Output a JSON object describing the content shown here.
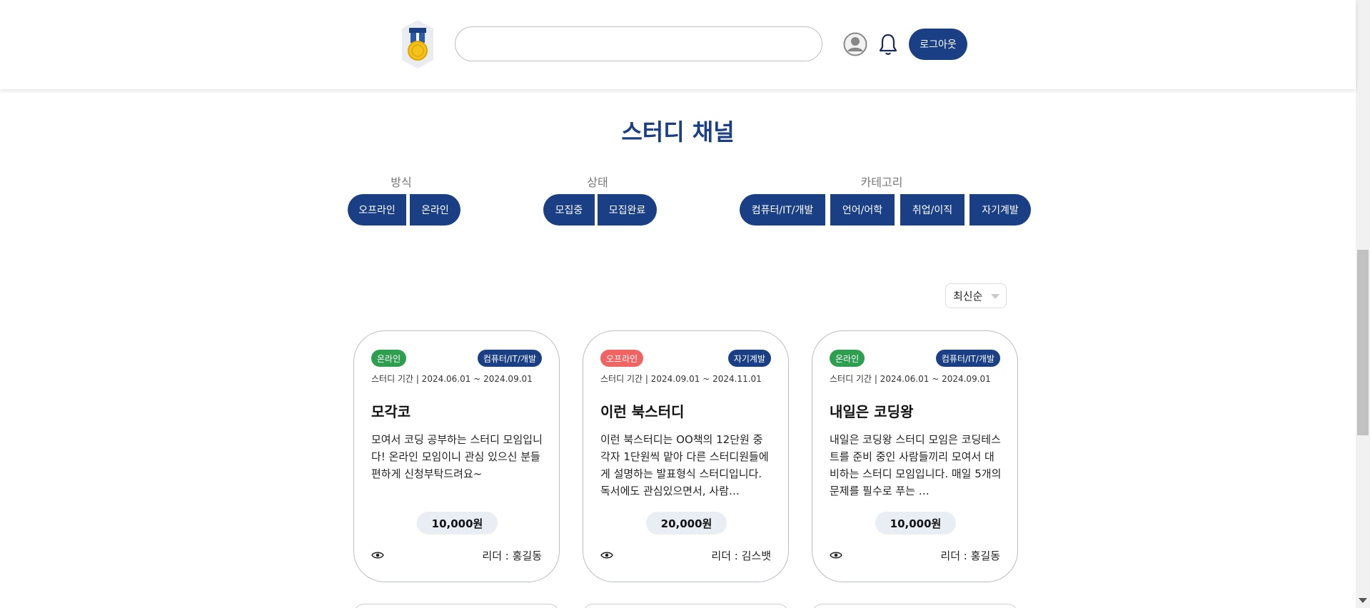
{
  "header": {
    "search_placeholder": "",
    "logout_label": "로그아웃"
  },
  "page": {
    "title": "스터디 채널"
  },
  "filters": {
    "method": {
      "label": "방식",
      "options": [
        "오프라인",
        "온라인"
      ]
    },
    "status": {
      "label": "상태",
      "options": [
        "모집중",
        "모집완료"
      ]
    },
    "category": {
      "label": "카테고리",
      "options": [
        "컴퓨터/IT/개발",
        "언어/어학",
        "취업/이직",
        "자기계발"
      ]
    }
  },
  "sort": {
    "selected": "최신순"
  },
  "cards": [
    {
      "mode": "온라인",
      "mode_color": "#2e9e4f",
      "category": "컴퓨터/IT/개발",
      "period": "스터디 기간 | 2024.06.01 ~ 2024.09.01",
      "title": "모각코",
      "description": "모여서 코딩 공부하는 스터디 모임입니다! 온라인 모임이니 관심 있으신 분들 편하게 신청부탁드려요~",
      "price": "10,000원",
      "leader": "리더 : 홍길동"
    },
    {
      "mode": "오프라인",
      "mode_color": "#f06464",
      "category": "자기계발",
      "period": "스터디 기간 | 2024.09.01 ~ 2024.11.01",
      "title": "이런 북스터디",
      "description": "이런 북스터디는 OO책의 12단원 중 각자 1단원씩 맡아 다른 스터디원들에게 설명하는 발표형식 스터디입니다. 독서에도 관심있으면서, 사람…",
      "price": "20,000원",
      "leader": "리더 : 김스뱃"
    },
    {
      "mode": "온라인",
      "mode_color": "#2e9e4f",
      "category": "컴퓨터/IT/개발",
      "period": "스터디 기간 | 2024.06.01 ~ 2024.09.01",
      "title": "내일은 코딩왕",
      "description": "내일은 코딩왕 스터디 모임은 코딩테스트를 준비 중인 사람들끼리 모여서 대비하는 스터디 모임입니다. 매일 5개의 문제를 필수로 푸는 …",
      "price": "10,000원",
      "leader": "리더 : 홍길동"
    }
  ],
  "colors": {
    "primary": "#1a3f85",
    "online": "#2e9e4f",
    "offline": "#f06464"
  }
}
